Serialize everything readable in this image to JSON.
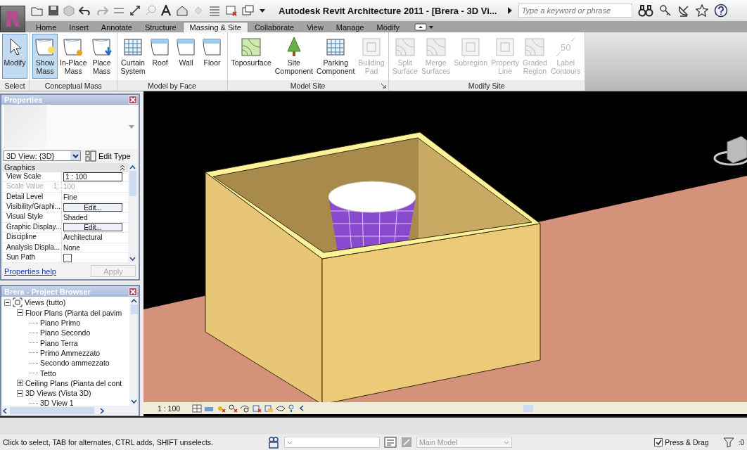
{
  "title_bar": {
    "title": "Autodesk Revit Architecture 2011 - [Brera - 3D Vi...",
    "search": {
      "placeholder": "Type a keyword or phrase"
    }
  },
  "tabs": [
    {
      "label": "Home",
      "selected": false
    },
    {
      "label": "Insert",
      "selected": false
    },
    {
      "label": "Annotate",
      "selected": false
    },
    {
      "label": "Structure",
      "selected": false
    },
    {
      "label": "Massing & Site",
      "selected": true
    },
    {
      "label": "Collaborate",
      "selected": false
    },
    {
      "label": "View",
      "selected": false
    },
    {
      "label": "Manage",
      "selected": false
    },
    {
      "label": "Modify",
      "selected": false
    }
  ],
  "ribbon_panels": [
    {
      "label": "Select",
      "tools": [
        {
          "label": "Modify",
          "kind": "cursor",
          "selected": true,
          "disabled": false
        }
      ]
    },
    {
      "label": "Conceptual Mass",
      "tools": [
        {
          "label": "Show\nMass",
          "kind": "mass",
          "selected": true,
          "disabled": false
        },
        {
          "label": "In-Place\nMass",
          "kind": "mass",
          "selected": false,
          "disabled": false
        },
        {
          "label": "Place\nMass",
          "kind": "mass",
          "selected": false,
          "disabled": false
        }
      ]
    },
    {
      "label": "Model by Face",
      "tools": [
        {
          "label": "Curtain\nSystem",
          "kind": "grid",
          "selected": false,
          "disabled": false
        },
        {
          "label": "Roof",
          "kind": "face",
          "selected": false,
          "disabled": false
        },
        {
          "label": "Wall",
          "kind": "face",
          "selected": false,
          "disabled": false
        },
        {
          "label": "Floor",
          "kind": "face",
          "selected": false,
          "disabled": false
        }
      ]
    },
    {
      "label": "Model Site",
      "launcher": true,
      "tools": [
        {
          "label": "Toposurface",
          "kind": "terrain",
          "selected": false,
          "disabled": false
        },
        {
          "label": "Site\nComponent",
          "kind": "tree",
          "selected": false,
          "disabled": false
        },
        {
          "label": "Parking\nComponent",
          "kind": "grid",
          "selected": false,
          "disabled": false
        },
        {
          "label": "Building\nPad",
          "kind": "square",
          "selected": false,
          "disabled": true
        }
      ]
    },
    {
      "label": "Modify Site",
      "tools": [
        {
          "label": "Split\nSurface",
          "kind": "terrain",
          "selected": false,
          "disabled": true
        },
        {
          "label": "Merge\nSurfaces",
          "kind": "terrain",
          "selected": false,
          "disabled": true
        },
        {
          "label": "Subregion",
          "kind": "square",
          "selected": false,
          "disabled": true
        },
        {
          "label": "Property\nLine",
          "kind": "square",
          "selected": false,
          "disabled": true
        },
        {
          "label": "Graded\nRegion",
          "kind": "terrain",
          "selected": false,
          "disabled": true
        },
        {
          "label": "Label\nContours",
          "kind": "label",
          "icon_text": "50",
          "selected": false,
          "disabled": true
        }
      ]
    }
  ],
  "properties": {
    "title": "Properties",
    "type_selector": "3D View: {3D}",
    "edit_type": "Edit Type",
    "group": "Graphics",
    "rows": [
      {
        "name": "View Scale",
        "kind": "input",
        "value": "1 : 100",
        "disabled": false
      },
      {
        "name": "Scale Value",
        "prefix": "1:",
        "kind": "text",
        "value": "100",
        "disabled": true
      },
      {
        "name": "Detail Level",
        "kind": "text",
        "value": "Fine",
        "disabled": false
      },
      {
        "name": "Visibility/Graphi...",
        "kind": "button",
        "value": "Edit...",
        "disabled": false
      },
      {
        "name": "Visual Style",
        "kind": "text",
        "value": "Shaded",
        "disabled": false
      },
      {
        "name": "Graphic Display...",
        "kind": "button",
        "value": "Edit...",
        "disabled": false
      },
      {
        "name": "Discipline",
        "kind": "text",
        "value": "Architectural",
        "disabled": false
      },
      {
        "name": "Analysis Displa...",
        "kind": "text",
        "value": "None",
        "disabled": false
      },
      {
        "name": "Sun Path",
        "kind": "checkbox",
        "checked": false,
        "disabled": false
      }
    ],
    "help_link": "Properties help",
    "apply": {
      "label": "Apply",
      "disabled": true
    }
  },
  "project_browser": {
    "title": "Brera - Project Browser",
    "tree": [
      {
        "label": "Views (tutto)",
        "expanded": true,
        "children": [
          {
            "label": "Floor Plans (Pianta del pavim",
            "expanded": true,
            "children": [
              {
                "label": "Piano Primo"
              },
              {
                "label": "Piano Secondo"
              },
              {
                "label": "Piano Terra"
              },
              {
                "label": "Primo Ammezzato"
              },
              {
                "label": "Secondo ammezzato"
              },
              {
                "label": "Tetto"
              }
            ]
          },
          {
            "label": "Ceiling Plans (Pianta del cont",
            "expanded": false
          },
          {
            "label": "3D Views (Vista 3D)",
            "expanded": true,
            "children": [
              {
                "label": "3D View 1"
              }
            ]
          }
        ]
      }
    ]
  },
  "view_bar": {
    "scale": "1 : 100"
  },
  "status_bar": {
    "message": "Click to select, TAB for alternates, CTRL adds, SHIFT unselects.",
    "model": "Main Model",
    "press_drag": {
      "label": "Press & Drag",
      "checked": true
    },
    "filter_count": ":0"
  }
}
